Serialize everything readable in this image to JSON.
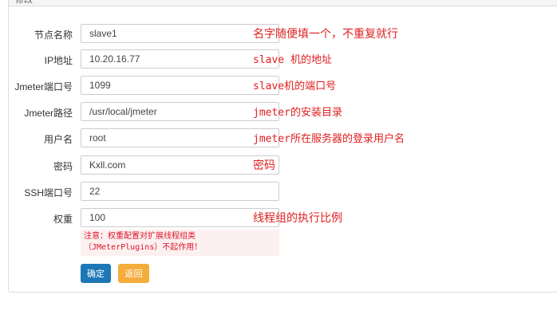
{
  "panel": {
    "title": "修改"
  },
  "form": {
    "rows": [
      {
        "label": "节点名称",
        "value": "slave1",
        "note": "名字随便填一个，不重复就行"
      },
      {
        "label": "IP地址",
        "value": "10.20.16.77",
        "note": "slave 机的地址"
      },
      {
        "label": "Jmeter端口号",
        "value": "1099",
        "note": "slave机的端口号"
      },
      {
        "label": "Jmeter路径",
        "value": "/usr/local/jmeter",
        "note": "jmeter的安装目录"
      },
      {
        "label": "用户名",
        "value": "root",
        "note": "jmeter所在服务器的登录用户名"
      },
      {
        "label": "密码",
        "value": "Kxll.com",
        "note": "密码"
      },
      {
        "label": "SSH端口号",
        "value": "22",
        "note": ""
      },
      {
        "label": "权重",
        "value": "100",
        "note": "线程组的执行比例"
      }
    ],
    "warning": {
      "line1": "注意：权重配置对扩展线程组类",
      "line2": "（JMeterPlugins）不起作用！"
    }
  },
  "buttons": {
    "confirm": "确定",
    "back": "返回"
  },
  "colors": {
    "note_red": "#e02020",
    "confirm_blue": "#1d77b6",
    "back_orange": "#f4ad3c",
    "warning_bg": "#fdf0f0"
  }
}
